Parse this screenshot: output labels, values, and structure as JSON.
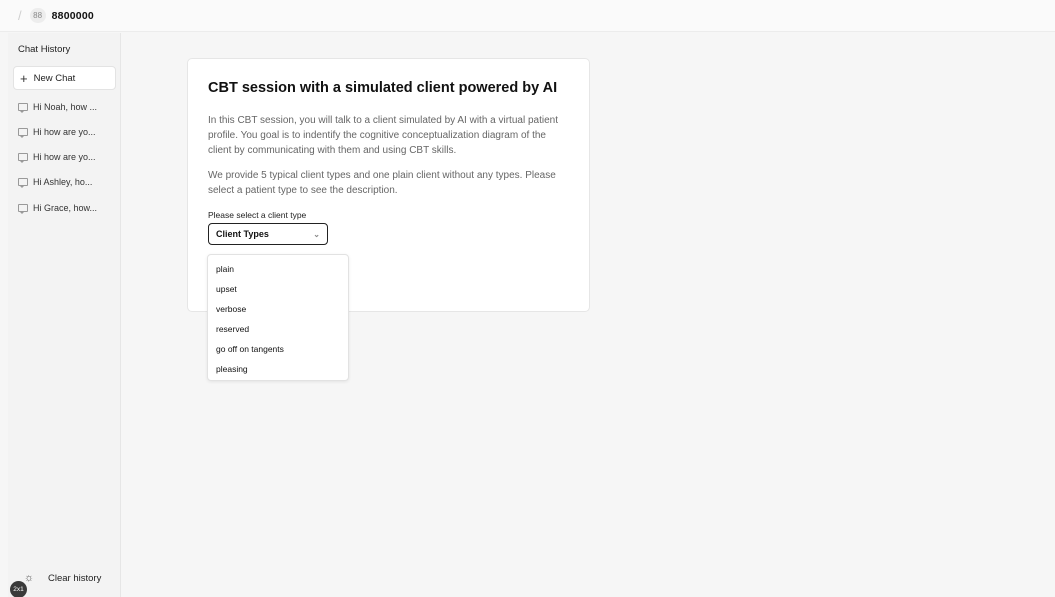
{
  "topbar": {
    "badge": "88",
    "project": "8800000"
  },
  "sidebar": {
    "heading": "Chat History",
    "new_chat": "New Chat",
    "history": [
      "Hi Noah, how ...",
      "Hi how are yo...",
      "Hi how are yo...",
      "Hi Ashley, ho...",
      "Hi Grace, how..."
    ],
    "clear": "Clear history",
    "corner_badge": "2x1"
  },
  "main": {
    "title": "CBT session with a simulated client powered by AI",
    "para1": "In this CBT session, you will talk to a client simulated by AI with a virtual patient profile. You goal is to indentify the cognitive conceptualization diagram of the client by communicating with them and using CBT skills.",
    "para2": "We provide 5 typical client types and one plain client without any types. Please select a patient type to see the description.",
    "select_label": "Please select a client type",
    "select_value": "Client Types",
    "options": [
      "plain",
      "upset",
      "verbose",
      "reserved",
      "go off on tangents",
      "pleasing"
    ]
  },
  "icons": {
    "new_chat": "plus-icon",
    "history_item": "chat-bubble-icon",
    "clear": "sun-icon",
    "select": "chevron-down-icon"
  }
}
